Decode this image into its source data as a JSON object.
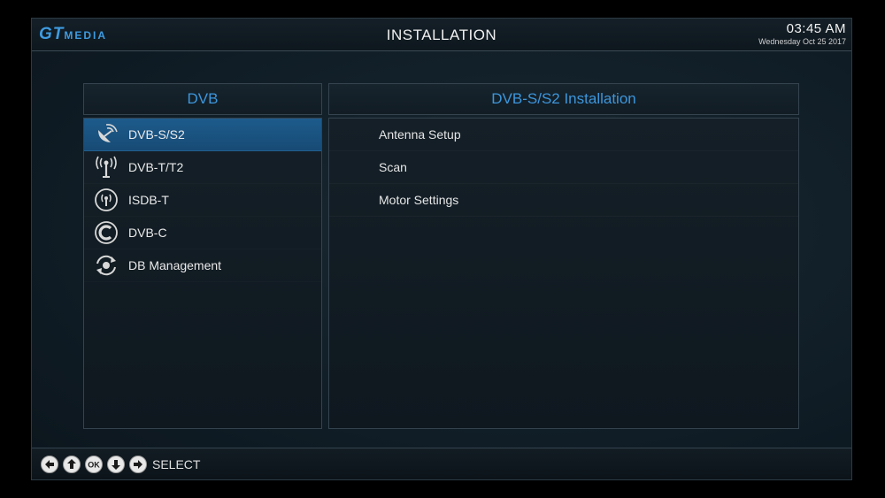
{
  "header": {
    "logo_gt": "GT",
    "logo_media": "MEDIA",
    "title": "INSTALLATION",
    "time": "03:45  AM",
    "date": "Wednesday  Oct 25 2017"
  },
  "left_panel": {
    "title": "DVB",
    "items": [
      {
        "label": "DVB-S/S2",
        "icon": "satellite-dish-icon",
        "selected": true
      },
      {
        "label": "DVB-T/T2",
        "icon": "antenna-tower-icon",
        "selected": false
      },
      {
        "label": "ISDB-T",
        "icon": "broadcast-icon",
        "selected": false
      },
      {
        "label": "DVB-C",
        "icon": "cable-c-icon",
        "selected": false
      },
      {
        "label": "DB Management",
        "icon": "database-management-icon",
        "selected": false
      }
    ]
  },
  "right_panel": {
    "title": "DVB-S/S2 Installation",
    "options": [
      "Antenna Setup",
      "Scan",
      "Motor Settings"
    ]
  },
  "footer": {
    "buttons": [
      "left-arrow-icon",
      "up-arrow-icon",
      "ok-icon",
      "down-arrow-icon",
      "right-arrow-icon"
    ],
    "label": "SELECT"
  },
  "colors": {
    "accent": "#3c96dc",
    "selected_row": "#1d5b8c",
    "background": "#12202a"
  }
}
